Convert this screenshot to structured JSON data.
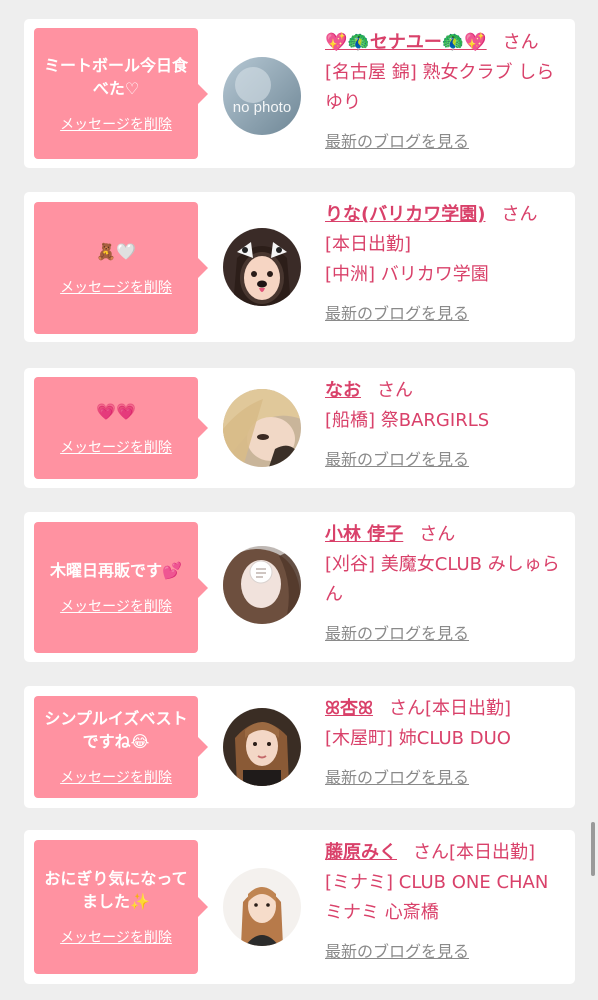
{
  "delete_label": "メッセージを削除",
  "blog_label": "最新のブログを見る",
  "honorific": "さん",
  "colors": {
    "background": "#eeeeee",
    "card": "#ffffff",
    "bubble": "#ff92a1",
    "accent_text": "#d9416a",
    "link_gray": "#8a8a8a"
  },
  "messages": [
    {
      "message": "ミートボール今日食べた♡",
      "name": "💖🦚セナユー🦚💖",
      "extra": "",
      "details": [
        "[名古屋 錦] 熟女クラブ しらゆり"
      ],
      "avatar": "no-photo-avatar",
      "avatar_text": "no photo"
    },
    {
      "message": "🧸🤍",
      "name": "りな(バリカワ学園)",
      "extra": "",
      "details": [
        "[本日出勤]",
        "[中洲] バリカワ学園"
      ],
      "avatar": "dog-filter-photo-avatar",
      "avatar_text": ""
    },
    {
      "message": "💗💗",
      "name": "なお",
      "extra": "",
      "details": [
        "[船橋] 祭BARGIRLS"
      ],
      "avatar": "blonde-photo-avatar",
      "avatar_text": ""
    },
    {
      "message": "木曜日再販です💕",
      "name": "小林 侼子",
      "extra": "",
      "details": [
        "[刈谷] 美魔女CLUB みしゅらん"
      ],
      "avatar": "mosaic-face-avatar",
      "avatar_text": ""
    },
    {
      "message": "シンプルイズベストですね😂",
      "name": "ꕤ杏ꕤ",
      "extra": "[本日出勤]",
      "details": [
        "[木屋町] 姉CLUB DUO"
      ],
      "avatar": "selfie-photo-avatar",
      "avatar_text": ""
    },
    {
      "message": "おにぎり気になってました✨",
      "name": "藤原みく",
      "extra": "[本日出勤]",
      "details": [
        "[ミナミ] CLUB ONE CHAN ミナミ 心斎橋"
      ],
      "avatar": "portrait-photo-avatar",
      "avatar_text": ""
    }
  ]
}
